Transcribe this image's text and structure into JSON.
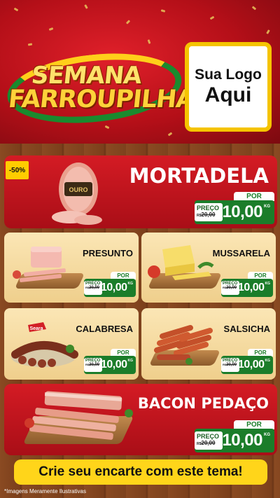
{
  "header": {
    "title_line1": "SEMANA",
    "title_line2": "FARROUPILHA",
    "logo_line1": "Sua Logo",
    "logo_line2": "Aqui"
  },
  "featured": {
    "badge": "-50%",
    "name": "MORTADELA",
    "brand_label": "OURO",
    "price": {
      "por": "POR",
      "preco": "PREÇO",
      "old_prefix": "R$",
      "old": "20,00",
      "currency": "R$",
      "value": "10,00",
      "unit": "KG"
    }
  },
  "grid": [
    {
      "name": "PRESUNTO",
      "price": {
        "por": "POR",
        "preco": "PREÇO",
        "old_prefix": "R$",
        "old": "20,00",
        "currency": "R$",
        "value": "10,00",
        "unit": "KG"
      }
    },
    {
      "name": "MUSSARELA",
      "price": {
        "por": "POR",
        "preco": "PREÇO",
        "old_prefix": "R$",
        "old": "20,00",
        "currency": "R$",
        "value": "10,00",
        "unit": "KG"
      }
    },
    {
      "name": "CALABRESA",
      "brand": "Seara",
      "price": {
        "por": "POR",
        "preco": "PREÇO",
        "old_prefix": "R$",
        "old": "20,00",
        "currency": "R$",
        "value": "10,00",
        "unit": "KG"
      }
    },
    {
      "name": "SALSICHA",
      "price": {
        "por": "POR",
        "preco": "PREÇO",
        "old_prefix": "R$",
        "old": "20,00",
        "currency": "R$",
        "value": "10,00",
        "unit": "KG"
      }
    }
  ],
  "bacon": {
    "name": "BACON PEDAÇO",
    "price": {
      "por": "POR",
      "preco": "PREÇO",
      "old_prefix": "R$",
      "old": "20,00",
      "currency": "R$",
      "value": "10,00",
      "unit": "KG"
    }
  },
  "footer": {
    "cta": "Crie seu encarte com este tema!",
    "disclaimer": "*Imagens Meramente Ilustrativas"
  },
  "colors": {
    "header_red": "#b40f18",
    "price_green": "#1b7d2a",
    "cta_yellow": "#ffd51a",
    "card_cream": "#fbe6b5"
  }
}
